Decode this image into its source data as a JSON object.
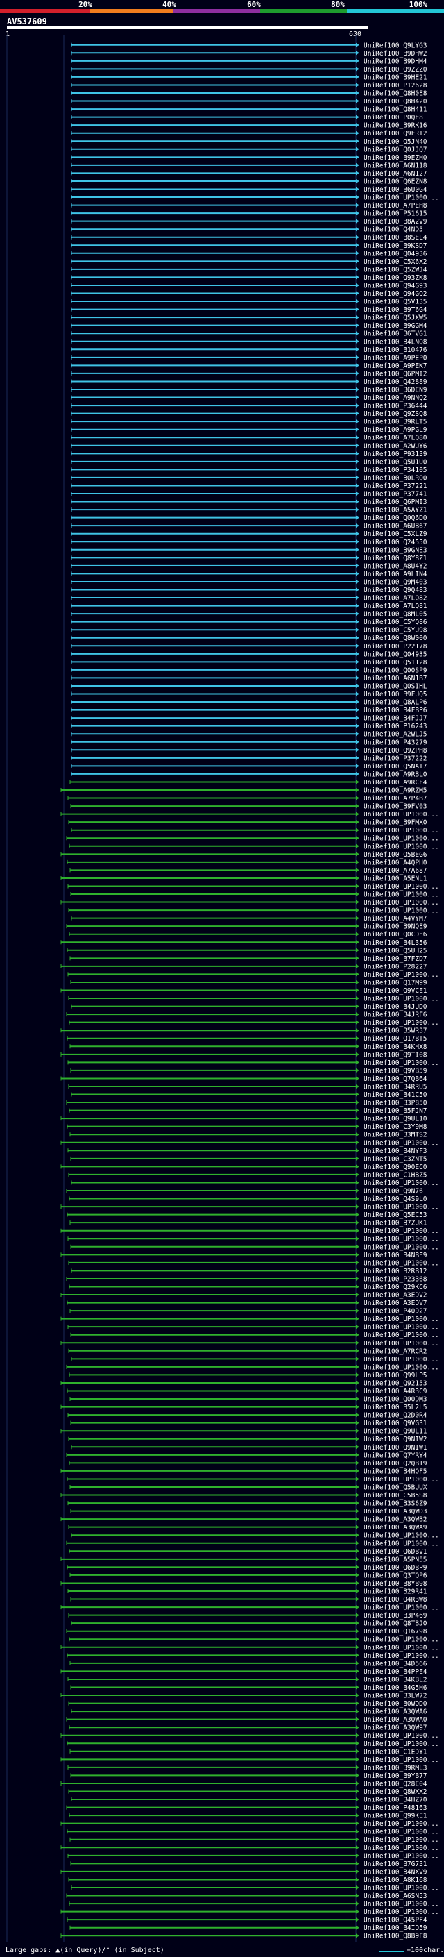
{
  "query": {
    "id": "AV537609",
    "start": "1",
    "end": "630"
  },
  "legend": {
    "labels": [
      "20%",
      "40%",
      "60%",
      "80%",
      "100%"
    ],
    "colors": [
      "#d21f2b",
      "#f07c1e",
      "#8e2ea0",
      "#1e9b2e",
      "#23c6d6"
    ]
  },
  "hit_colors": {
    "high": "#3fc3e6",
    "mid": "#2fb02d"
  },
  "footer": {
    "gaps_text": "Large gaps: ▲(in Query)/⌃ (in Subject)",
    "scale_text": "=100char."
  },
  "hits": [
    "UniRef100_Q9LYG3",
    "UniRef100_B9DHW2",
    "UniRef100_B9DHM4",
    "UniRef100_Q9ZZZ0",
    "UniRef100_B9HE21",
    "UniRef100_P12628",
    "UniRef100_Q8H0E8",
    "UniRef100_Q8H420",
    "UniRef100_Q8H411",
    "UniRef100_P0QE8",
    "UniRef100_B9RK16",
    "UniRef100_Q9FRT2",
    "UniRef100_Q5JN40",
    "UniRef100_Q0JJQ7",
    "UniRef100_B9EZH0",
    "UniRef100_A6N118",
    "UniRef100_A6N127",
    "UniRef100_Q6EZN8",
    "UniRef100_B6U0G4",
    "UniRef100_UP1000...",
    "UniRef100_A7PEH8",
    "UniRef100_P51615",
    "UniRef100_B8A2V9",
    "UniRef100_Q4ND5",
    "UniRef100_B8SEL4",
    "UniRef100_B9KSD7",
    "UniRef100_Q04936",
    "UniRef100_C5X6X2",
    "UniRef100_Q5ZWJ4",
    "UniRef100_Q93ZK8",
    "UniRef100_Q94G93",
    "UniRef100_Q94GQ2",
    "UniRef100_Q5V135",
    "UniRef100_B9T6G4",
    "UniRef100_Q5JXW5",
    "UniRef100_B9GGM4",
    "UniRef100_B6TVG1",
    "UniRef100_B4LNQ8",
    "UniRef100_B10476",
    "UniRef100_A9PEP0",
    "UniRef100_A9PEK7",
    "UniRef100_Q6PMI2",
    "UniRef100_Q42889",
    "UniRef100_B6DEN9",
    "UniRef100_A9NNQ2",
    "UniRef100_P36444",
    "UniRef100_Q9ZSQ8",
    "UniRef100_B9RLT5",
    "UniRef100_A9PGL9",
    "UniRef100_A7LQ80",
    "UniRef100_A2WUY6",
    "UniRef100_P93139",
    "UniRef100_Q5U1U0",
    "UniRef100_P34105",
    "UniRef100_B0LRQ0",
    "UniRef100_P37221",
    "UniRef100_P37741",
    "UniRef100_Q6PMI3",
    "UniRef100_A5AYZ1",
    "UniRef100_Q0Q6D0",
    "UniRef100_A6UB67",
    "UniRef100_C5XLZ9",
    "UniRef100_Q24550",
    "UniRef100_B9GNE3",
    "UniRef100_Q8Y8Z1",
    "UniRef100_A8U4Y2",
    "UniRef100_A9LIN4",
    "UniRef100_Q9M403",
    "UniRef100_Q9Q483",
    "UniRef100_A7LQ82",
    "UniRef100_A7LQ81",
    "UniRef100_Q8ML05",
    "UniRef100_C5YQ86",
    "UniRef100_C5YU98",
    "UniRef100_Q8W000",
    "UniRef100_P22178",
    "UniRef100_Q04935",
    "UniRef100_Q51128",
    "UniRef100_Q00SP9",
    "UniRef100_A6N1B7",
    "UniRef100_Q0SIHL",
    "UniRef100_B9FUQ5",
    "UniRef100_Q8ALP6",
    "UniRef100_B4FBP6",
    "UniRef100_B4FJJ7",
    "UniRef100_P16243",
    "UniRef100_A2WLJ5",
    "UniRef100_P43279",
    "UniRef100_Q9ZPH8",
    "UniRef100_P37222",
    "UniRef100_Q5NAT7",
    "UniRef100_A9RBL0",
    "UniRef100_A9RCF4",
    "UniRef100_A9RZM5",
    "UniRef100_A7P4B7",
    "UniRef100_B9FV03",
    "UniRef100_UP1000...",
    "UniRef100_B9FMX0",
    "UniRef100_UP1000...",
    "UniRef100_UP1000...",
    "UniRef100_UP1000...",
    "UniRef100_Q5BEG6",
    "UniRef100_A4QPH0",
    "UniRef100_A7A687",
    "UniRef100_A5ENL1",
    "UniRef100_UP1000...",
    "UniRef100_UP1000...",
    "UniRef100_UP1000...",
    "UniRef100_UP1000...",
    "UniRef100_A4VYM7",
    "UniRef100_B9NQE9",
    "UniRef100_Q0CDE6",
    "UniRef100_B4L356",
    "UniRef100_Q5UH25",
    "UniRef100_B7FZD7",
    "UniRef100_P28227",
    "UniRef100_UP1000...",
    "UniRef100_Q17M99",
    "UniRef100_Q9VCE1",
    "UniRef100_UP1000...",
    "UniRef100_B4JUD0",
    "UniRef100_B4JRF6",
    "UniRef100_UP1000...",
    "UniRef100_B5WR37",
    "UniRef100_Q17BT5",
    "UniRef100_B4KHX8",
    "UniRef100_Q9TI08",
    "UniRef100_UP1000...",
    "UniRef100_Q9VB59",
    "UniRef100_Q7QB64",
    "UniRef100_B4RRU5",
    "UniRef100_B41C50",
    "UniRef100_B3P850",
    "UniRef100_B5FJN7",
    "UniRef100_Q9UL10",
    "UniRef100_C3Y9M8",
    "UniRef100_B3MTS2",
    "UniRef100_UP1000...",
    "UniRef100_B4NYF3",
    "UniRef100_C3ZNT5",
    "UniRef100_Q90EC0",
    "UniRef100_C1HBZ5",
    "UniRef100_UP1000...",
    "UniRef100_Q9N76",
    "UniRef100_Q4S9L0",
    "UniRef100_UP1000...",
    "UniRef100_Q5EC53",
    "UniRef100_B7ZUK1",
    "UniRef100_UP1000...",
    "UniRef100_UP1000...",
    "UniRef100_UP1000...",
    "UniRef100_B4NBE9",
    "UniRef100_UP1000...",
    "UniRef100_B2RB12",
    "UniRef100_P23368",
    "UniRef100_Q29KC6",
    "UniRef100_A3EDV2",
    "UniRef100_A3EDV7",
    "UniRef100_P40927",
    "UniRef100_UP1000...",
    "UniRef100_UP1000...",
    "UniRef100_UP1000...",
    "UniRef100_UP1000...",
    "UniRef100_A7RCR2",
    "UniRef100_UP1000...",
    "UniRef100_UP1000...",
    "UniRef100_Q99LP5",
    "UniRef100_Q92153",
    "UniRef100_A4R3C9",
    "UniRef100_Q00DM3",
    "UniRef100_B5L2L5",
    "UniRef100_Q2D0R4",
    "UniRef100_Q9VG31",
    "UniRef100_Q9UL11",
    "UniRef100_Q9NIW2",
    "UniRef100_Q9NIW1",
    "UniRef100_Q7YRY4",
    "UniRef100_Q2QB19",
    "UniRef100_B4HOF5",
    "UniRef100_UP1000...",
    "UniRef100_Q5BUUX",
    "UniRef100_C5B5S8",
    "UniRef100_B3S6Z9",
    "UniRef100_A3QWD3",
    "UniRef100_A3QWB2",
    "UniRef100_A3QWA9",
    "UniRef100_UP1000...",
    "UniRef100_UP1000...",
    "UniRef100_Q6DBV1",
    "UniRef100_A5PN55",
    "UniRef100_Q6DBP9",
    "UniRef100_Q3TQP6",
    "UniRef100_B8YB98",
    "UniRef100_B29R41",
    "UniRef100_Q4R3W8",
    "UniRef100_UP1000...",
    "UniRef100_B3P469",
    "UniRef100_Q8TBJ0",
    "UniRef100_Q16798",
    "UniRef100_UP1000...",
    "UniRef100_UP1000...",
    "UniRef100_UP1000...",
    "UniRef100_B4D566",
    "UniRef100_B4PPE4",
    "UniRef100_B4KBL2",
    "UniRef100_B4G5H6",
    "UniRef100_B3LW72",
    "UniRef100_B0WQD0",
    "UniRef100_A3QWA6",
    "UniRef100_A3QWA0",
    "UniRef100_A3QW97",
    "UniRef100_UP1000...",
    "UniRef100_UP1000...",
    "UniRef100_C1EDY1",
    "UniRef100_UP1000...",
    "UniRef100_B9RML3",
    "UniRef100_B9YB77",
    "UniRef100_Q28E04",
    "UniRef100_Q8WXX2",
    "UniRef100_B4HZ70",
    "UniRef100_P48163",
    "UniRef100_Q99KE1",
    "UniRef100_UP1000...",
    "UniRef100_UP1000...",
    "UniRef100_UP1000...",
    "UniRef100_UP1000...",
    "UniRef100_UP1000...",
    "UniRef100_B7G731",
    "UniRef100_B4NXV9",
    "UniRef100_A8K168",
    "UniRef100_UP1000...",
    "UniRef100_A6SN53",
    "UniRef100_UP1000...",
    "UniRef100_UP1000...",
    "UniRef100_Q45PF4",
    "UniRef100_B4ID59",
    "UniRef100_Q8B9F8"
  ]
}
